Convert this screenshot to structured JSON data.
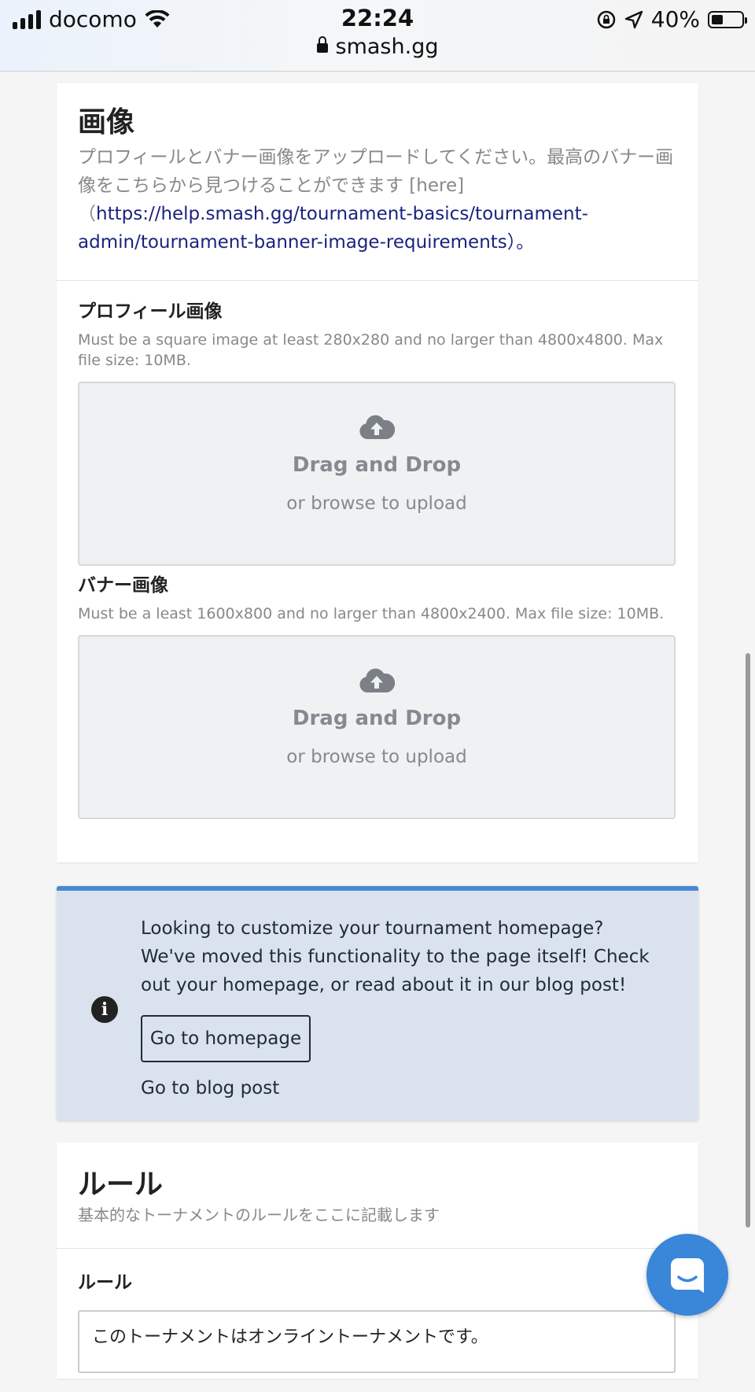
{
  "status_bar": {
    "carrier": "docomo",
    "time": "22:24",
    "url": "smash.gg",
    "battery": "40%"
  },
  "images_section": {
    "title": "画像",
    "description": "プロフィールとバナー画像をアップロードしてください。最高のバナー画像をこちらから見つけることができます [here]",
    "link_open": "（",
    "link_text": "https://help.smash.gg/tournament-basics/tournament-admin/tournament-banner-image-requirements",
    "link_close": "）。",
    "profile": {
      "label": "プロフィール画像",
      "hint": "Must be a square image at least 280x280 and no larger than 4800x4800. Max file size: 10MB.",
      "dz_title": "Drag and Drop",
      "dz_sub": "or browse to upload"
    },
    "banner": {
      "label": "バナー画像",
      "hint": "Must be a least 1600x800 and no larger than 4800x2400. Max file size: 10MB.",
      "dz_title": "Drag and Drop",
      "dz_sub": "or browse to upload"
    }
  },
  "info_box": {
    "text": "Looking to customize your tournament homepage? We've moved this functionality to the page itself! Check out your homepage, or read about it in our blog post!",
    "button_label": "Go to homepage",
    "link_label": "Go to blog post",
    "icon": "info-icon",
    "accent_color": "#4a8ad4"
  },
  "rules_section": {
    "title": "ルール",
    "description": "基本的なトーナメントのルールをここに記載します",
    "field_label": "ルール",
    "field_value": "このトーナメントはオンライントーナメントです。"
  },
  "chat_icon": "chat-icon"
}
